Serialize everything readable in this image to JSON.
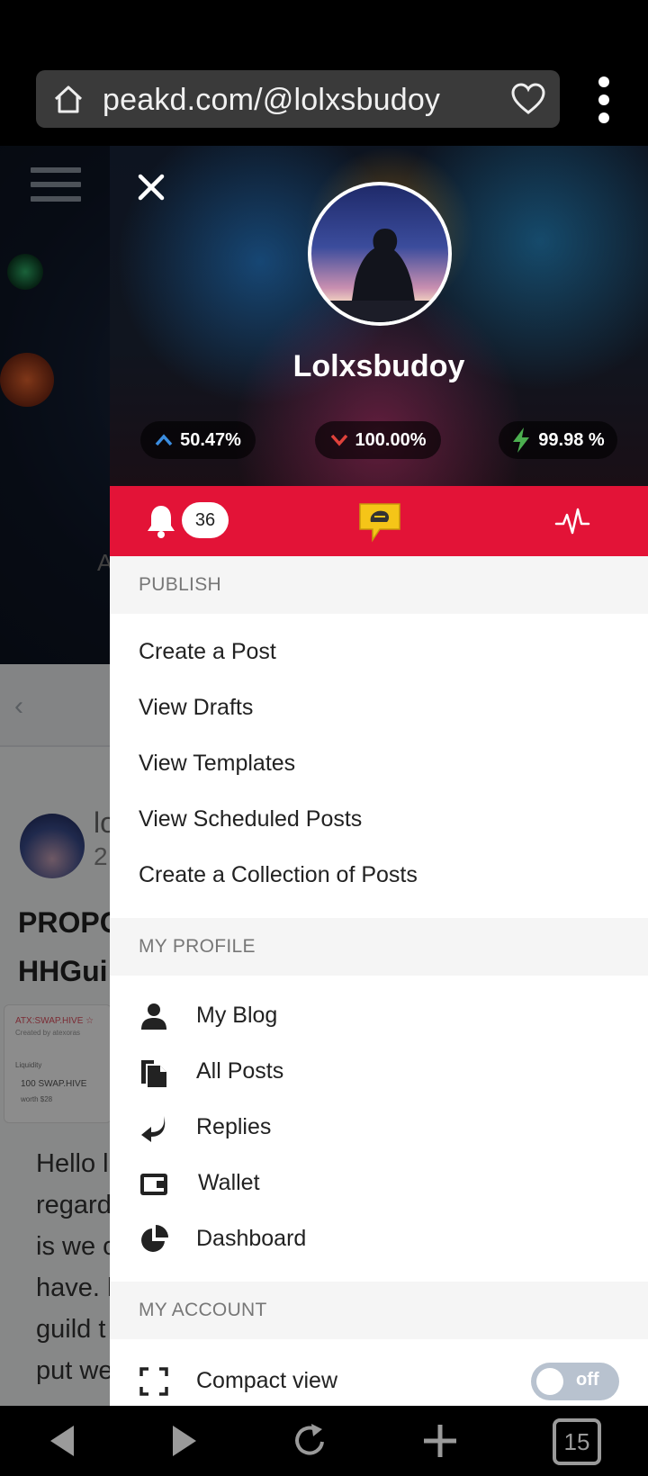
{
  "browser": {
    "url": "peakd.com/@lolxsbudoy",
    "tab_count": "15"
  },
  "background_page": {
    "partial_letter": "A",
    "author_partial": "lo",
    "date_partial": "2",
    "title_partial_1": "PROPC",
    "title_partial_2": "HHGui",
    "card": {
      "token": "ATX:SWAP.HIVE ☆",
      "created_by": "Created by atexoras",
      "liquidity_label": "Liquidity",
      "amount": "100 SWAP.HIVE",
      "worth": "worth $28"
    },
    "body_lines": [
      "Hello l",
      "regard",
      "is we c",
      "have. l",
      "guild t",
      "put we"
    ]
  },
  "drawer": {
    "profile": {
      "name": "Lolxsbudoy",
      "upvote_power": "50.47%",
      "downvote_power": "100.00%",
      "resource_credits": "99.98 %"
    },
    "notifications_count": "36",
    "sections": {
      "publish": {
        "header": "PUBLISH",
        "items": [
          "Create a Post",
          "View Drafts",
          "View Templates",
          "View Scheduled Posts",
          "Create a Collection of Posts"
        ]
      },
      "my_profile": {
        "header": "MY PROFILE",
        "items": [
          {
            "label": "My Blog",
            "icon": "user-icon"
          },
          {
            "label": "All Posts",
            "icon": "documents-icon"
          },
          {
            "label": "Replies",
            "icon": "reply-icon"
          },
          {
            "label": "Wallet",
            "icon": "wallet-icon"
          },
          {
            "label": "Dashboard",
            "icon": "pie-chart-icon"
          }
        ]
      },
      "my_account": {
        "header": "MY ACCOUNT",
        "compact_view_label": "Compact view",
        "compact_view_state": "off"
      }
    }
  },
  "colors": {
    "accent_red": "#e31337",
    "upvote_blue": "#3b8de0",
    "downvote_red": "#e0423b",
    "rc_green": "#4caf50",
    "chat_yellow": "#f5c518"
  }
}
